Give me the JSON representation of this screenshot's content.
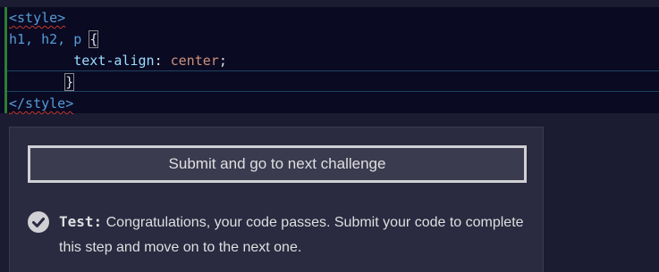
{
  "editor": {
    "lines": {
      "l1_tag_open": "<style>",
      "l2_selector": "h1, h2, p",
      "l2_brace": "{",
      "l3_indent": "        ",
      "l3_property": "text-align",
      "l3_colon": ": ",
      "l3_value": "center",
      "l3_semicolon": ";",
      "l4_indent": "       ",
      "l4_brace": "}",
      "l5_tag_close": "</style>"
    }
  },
  "panel": {
    "submit_label": "Submit and go to next challenge",
    "test_label": "Test:",
    "test_message": " Congratulations, your code passes. Submit your code to complete this step and move on to the next one."
  },
  "colors": {
    "background": "#1b1b32",
    "editor_bg": "#0a0a23",
    "modified_gutter": "#2e7d32",
    "tag": "#569cd6",
    "value": "#ce9178"
  },
  "icons": {
    "test_status": "check-circle-icon"
  }
}
